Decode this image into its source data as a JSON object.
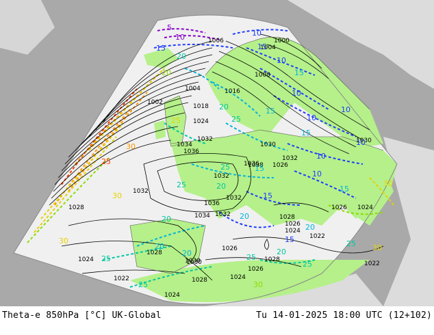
{
  "footer": {
    "left_text": "Theta-e 850hPa [°C] UK-Global",
    "right_text": "Tu 14-01-2025 18:00 UTC (12+102)"
  },
  "colors": {
    "ocean_background": "#a9a9a9",
    "land_outside": "#dcdcdc",
    "sea_domain": "#f0f0f0",
    "land_domain": "#b5f08a",
    "isobar": "#000000",
    "theta_cold": "#8800cc",
    "theta_cool": "#1e3cff",
    "theta_mid": "#00b4dc",
    "theta_teal": "#00c8a0",
    "theta_green": "#8cdc00",
    "theta_yellow": "#e6d200",
    "theta_orange": "#ff9600",
    "theta_red": "#ff3c00"
  },
  "pressure_labels": [
    "1002",
    "1004",
    "1006",
    "1008",
    "1000",
    "1004",
    "1016",
    "1018",
    "1024",
    "1032",
    "1034",
    "1036",
    "1030",
    "1036",
    "1032",
    "1030",
    "1032",
    "1032",
    "1028",
    "1026",
    "1024",
    "1034",
    "1032",
    "1030",
    "1028",
    "1026",
    "1024",
    "1022",
    "1026",
    "1028",
    "1024",
    "1022",
    "1028",
    "1024",
    "1024",
    "1026",
    "1032",
    "1036",
    "1030",
    "1038",
    "1028",
    "1026",
    "1022"
  ],
  "theta_labels": [
    "15",
    "10",
    "5",
    "15",
    "20",
    "10",
    "15",
    "10",
    "20",
    "25",
    "15",
    "10",
    "10",
    "15",
    "20",
    "25",
    "10",
    "15",
    "20",
    "25",
    "30",
    "25",
    "30",
    "20",
    "25",
    "15",
    "20",
    "25",
    "20",
    "15",
    "25",
    "30",
    "20",
    "25",
    "30",
    "25",
    "20",
    "30",
    "25",
    "10",
    "15",
    "10",
    "10",
    "20",
    "30"
  ],
  "icons": [
    "map-domain",
    "coastline"
  ]
}
